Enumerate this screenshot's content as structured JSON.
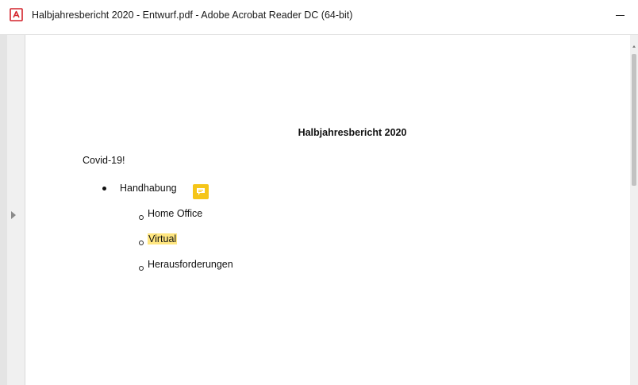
{
  "window": {
    "title": "Halbjahresbericht 2020 - Entwurf.pdf - Adobe Acrobat Reader DC (64-bit)",
    "app_icon": "pdf-icon"
  },
  "controls": {
    "minimize": "minimize-icon"
  },
  "document": {
    "title": "Halbjahresbericht 2020",
    "heading": "Covid-19!",
    "bullet": "Handhabung",
    "sub_items": [
      "Home Office",
      "Virtual",
      "Herausforderungen"
    ],
    "highlighted_item": "Virtual"
  },
  "annotation": {
    "icon": "comment-icon",
    "color": "#f5c518"
  },
  "colors": {
    "highlight": "#ffe680",
    "pdf_red": "#d4232b"
  }
}
